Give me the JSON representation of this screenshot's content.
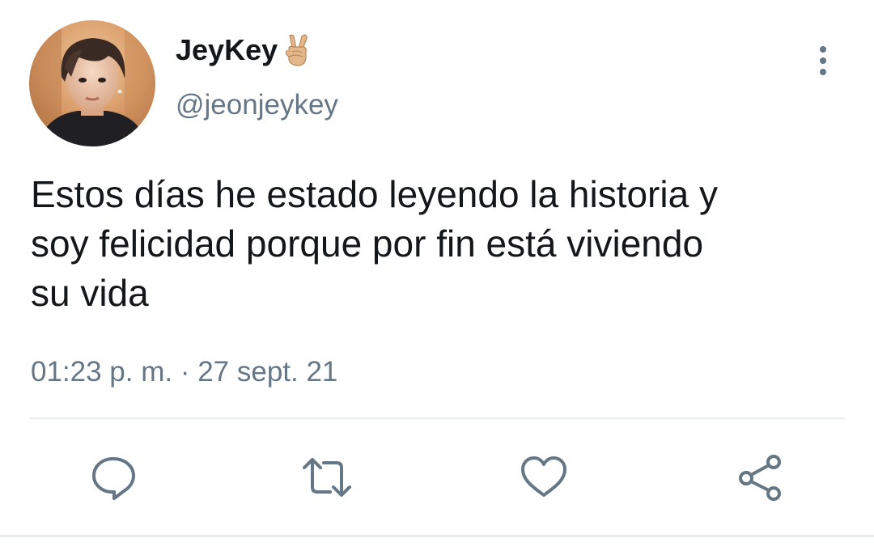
{
  "tweet": {
    "author": {
      "display_name": "JeyKey",
      "badge_icon": "victory-hand-emoji",
      "handle": "@jeonjeykey",
      "avatar": "profile-photo"
    },
    "text": "Estos días he estado leyendo la historia y\nsoy felicidad porque por fin está viviendo\nsu vida",
    "timestamp": "01:23 p. m. · 27 sept. 21",
    "actions": [
      {
        "name": "reply",
        "icon": "speech-bubble-icon"
      },
      {
        "name": "retweet",
        "icon": "retweet-arrows-icon"
      },
      {
        "name": "like",
        "icon": "heart-outline-icon"
      },
      {
        "name": "share",
        "icon": "share-nodes-icon"
      }
    ],
    "more_icon": "vertical-dots-icon"
  },
  "colors": {
    "primary_text": "#14171a",
    "secondary_text": "#657786",
    "icon": "#657786",
    "divider": "#e6ecf0",
    "background": "#ffffff"
  }
}
